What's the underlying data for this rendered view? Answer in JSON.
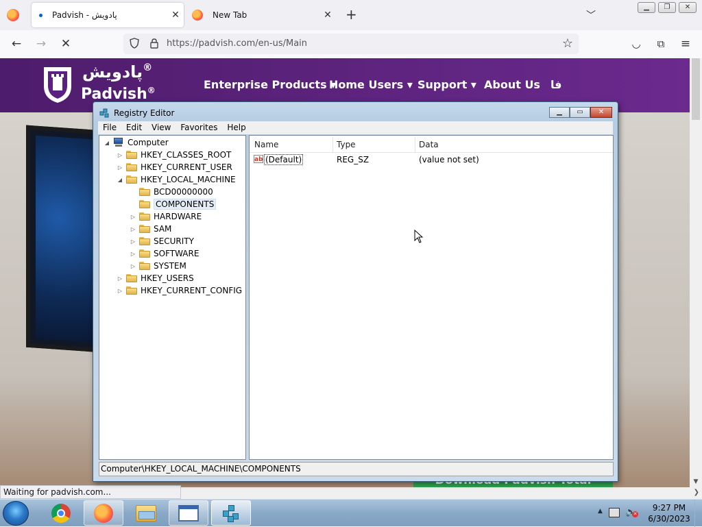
{
  "browser": {
    "tabs": [
      {
        "title": "Padvish - پادویش",
        "active": true
      },
      {
        "title": "New Tab",
        "active": false
      }
    ],
    "url": "https://padvish.com/en-us/Main",
    "status": "Waiting for padvish.com..."
  },
  "site": {
    "brand_fa": "پادویش",
    "brand_en": "Padvish",
    "registered": "®",
    "nav": [
      "Enterprise Products",
      "Home Users",
      "Support",
      "About Us",
      "فا"
    ],
    "download_banner": "Download Padvish Total Security"
  },
  "regedit": {
    "title": "Registry Editor",
    "menu": [
      "File",
      "Edit",
      "View",
      "Favorites",
      "Help"
    ],
    "tree": {
      "root": "Computer",
      "hives": [
        "HKEY_CLASSES_ROOT",
        "HKEY_CURRENT_USER",
        "HKEY_LOCAL_MACHINE"
      ],
      "hklm_children": [
        "BCD00000000",
        "COMPONENTS",
        "HARDWARE",
        "SAM",
        "SECURITY",
        "SOFTWARE",
        "SYSTEM"
      ],
      "after": [
        "HKEY_USERS",
        "HKEY_CURRENT_CONFIG"
      ],
      "selected": "COMPONENTS"
    },
    "columns": [
      "Name",
      "Type",
      "Data"
    ],
    "values": [
      {
        "name": "(Default)",
        "type": "REG_SZ",
        "data": "(value not set)"
      }
    ],
    "status_path": "Computer\\HKEY_LOCAL_MACHINE\\COMPONENTS"
  },
  "taskbar": {
    "apps": [
      "chrome-icon",
      "firefox-icon",
      "explorer-icon",
      "window-icon",
      "regedit-icon"
    ],
    "clock_time": "9:27 PM",
    "clock_date": "6/30/2023"
  },
  "colors": {
    "site_header": "#5a2180",
    "download_green": "#2ea44f",
    "selection": "#e5eef8"
  }
}
